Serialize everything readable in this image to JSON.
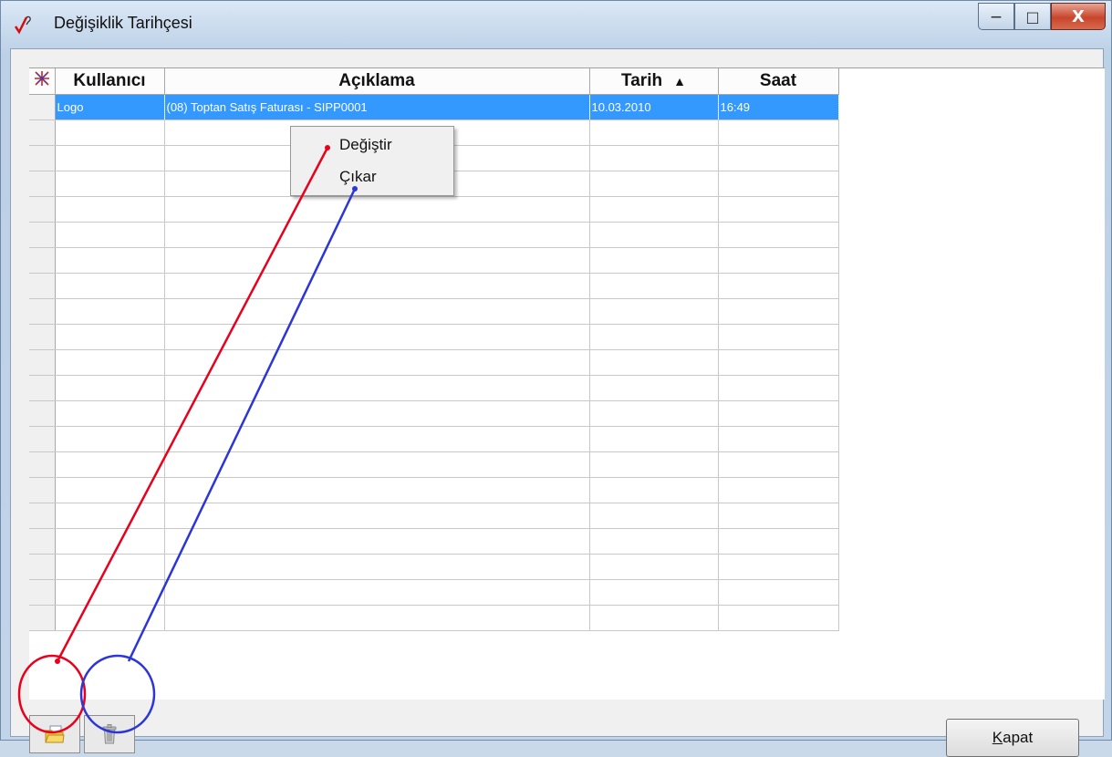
{
  "window": {
    "title": "Değişiklik Tarihçesi",
    "minimize_label": "—",
    "maximize_label": "□",
    "close_label": "X"
  },
  "grid": {
    "columns": [
      "Kullanıcı",
      "Açıklama",
      "Tarih",
      "Saat"
    ],
    "sort_indicator": "▲",
    "rows": [
      {
        "user": "Logo",
        "description": "(08) Toptan Satış Faturası - SIPP0001",
        "date": "10.03.2010",
        "time": "16:49"
      }
    ],
    "empty_rows": 20
  },
  "context_menu": {
    "items": [
      "Değiştir",
      "Çıkar"
    ]
  },
  "buttons": {
    "open_icon": "folder-open-icon",
    "delete_icon": "trash-icon",
    "close_access_key": "K",
    "close_rest": "apat"
  },
  "colors": {
    "selection": "#3399ff",
    "annotation_red": "#e8001c",
    "annotation_blue": "#2b35d8"
  }
}
